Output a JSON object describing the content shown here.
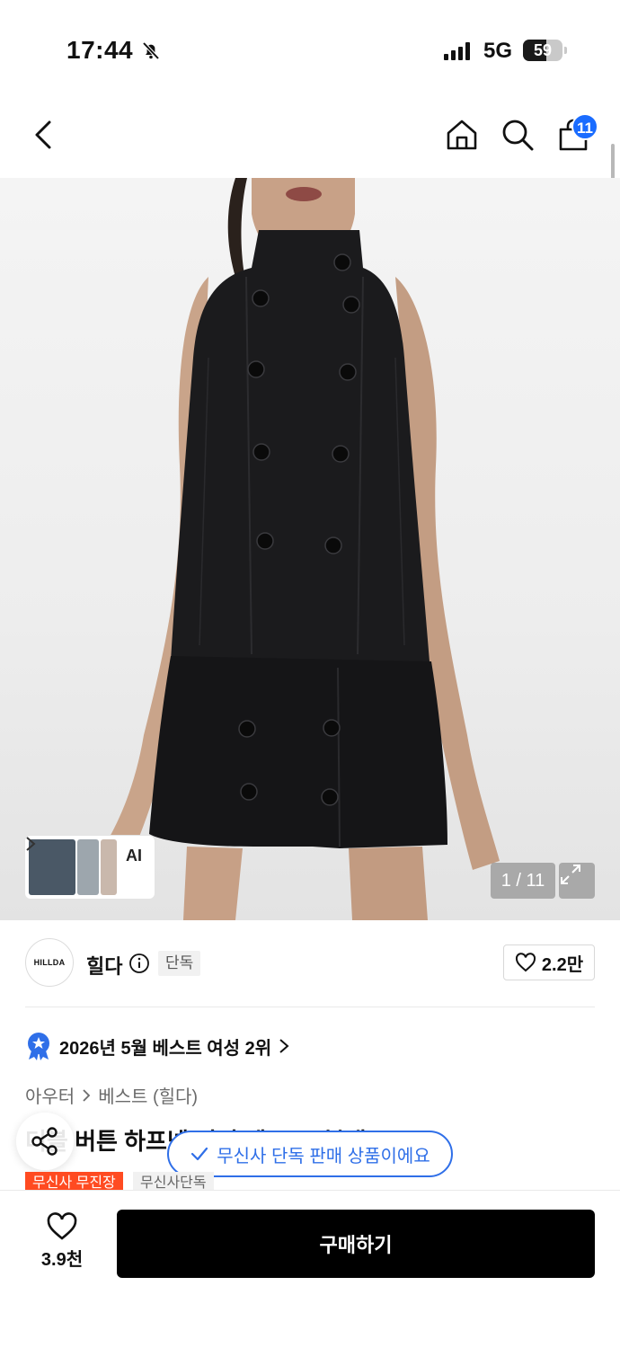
{
  "status_bar": {
    "time": "17:44",
    "network": "5G",
    "battery": "59",
    "battery_level": 0.59,
    "icons": [
      "bell-off-icon",
      "signal-icon"
    ]
  },
  "nav": {
    "icons": [
      "back-arrow-icon",
      "home-icon",
      "search-icon",
      "shopping-bag-icon"
    ],
    "cart_badge": "11"
  },
  "hero": {
    "image": "product-photo-black-double-breasted-vest-and-mini-skirt",
    "ai_label": "AI",
    "page_counter": "1 / 11"
  },
  "brand": {
    "logo_text": "HILLDA",
    "name": "힐다",
    "exclusive_badge": "단독",
    "like_count": "2.2만"
  },
  "ranking": {
    "text": "2026년 5월 베스트 여성 2위"
  },
  "breadcrumb": {
    "category": "아우터",
    "subcategory": "베스트 (힐다)"
  },
  "product": {
    "title": "더블 버튼 하프넥 미니 베스트 (블랙)"
  },
  "toast": {
    "text": "무신사 단독 판매 상품이에요"
  },
  "tags": {
    "tag1": "무신사 무진장",
    "tag2": "무신사단독"
  },
  "bottom_bar": {
    "wish_count": "3.9천",
    "buy_label": "구매하기"
  },
  "colors": {
    "accent_blue": "#2f6fe8",
    "badge_blue": "#1a6cff",
    "tag_red": "#ff4b21",
    "buy_black": "#000000"
  }
}
